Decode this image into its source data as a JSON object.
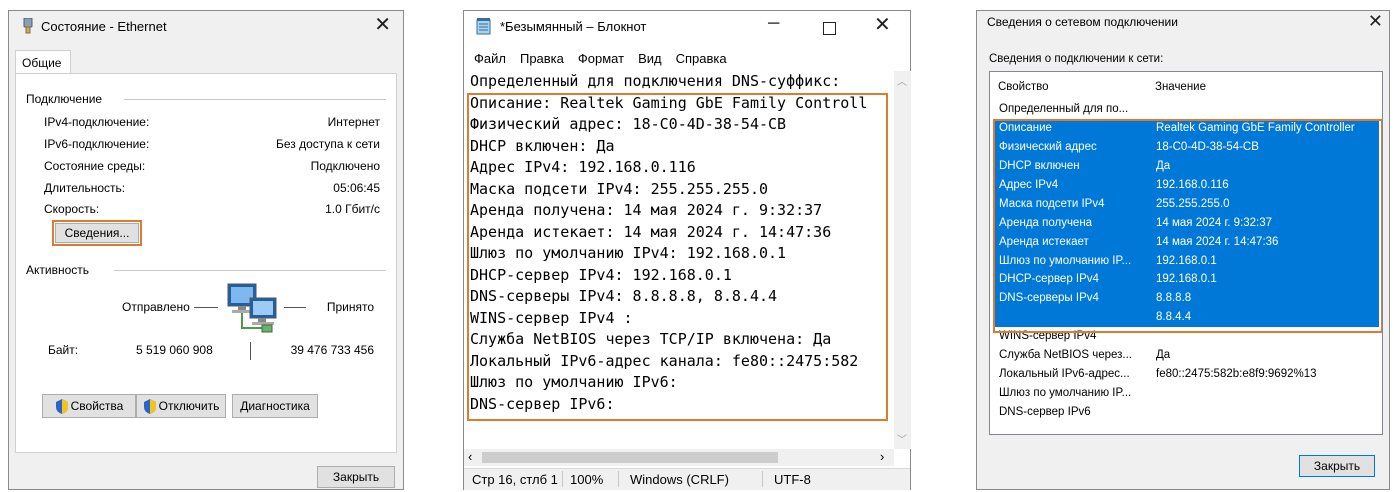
{
  "win1": {
    "title": "Состояние - Ethernet",
    "tab": "Общие",
    "connection_header": "Подключение",
    "rows": [
      {
        "label": "IPv4-подключение:",
        "value": "Интернет"
      },
      {
        "label": "IPv6-подключение:",
        "value": "Без доступа к сети"
      },
      {
        "label": "Состояние среды:",
        "value": "Подключено"
      },
      {
        "label": "Длительность:",
        "value": "05:06:45"
      },
      {
        "label": "Скорость:",
        "value": "1.0 Гбит/с"
      }
    ],
    "details_button": "Сведения...",
    "activity_header": "Активность",
    "sent_label": "Отправлено",
    "received_label": "Принято",
    "bytes_label": "Байт:",
    "bytes_sent": "5 519 060 908",
    "bytes_received": "39 476 733 456",
    "properties_button": "Свойства",
    "disable_button": "Отключить",
    "diagnose_button": "Диагностика",
    "close_button": "Закрыть"
  },
  "win2": {
    "title": "*Безымянный – Блокнот",
    "menu": [
      "Файл",
      "Правка",
      "Формат",
      "Вид",
      "Справка"
    ],
    "lines": [
      "Определенный для подключения DNS-суффикс:",
      "Описание: Realtek Gaming GbE Family Controll",
      "Физический адрес: 18-C0-4D-38-54-CB",
      "DHCP включен: Да",
      "Адрес IPv4: 192.168.0.116",
      "Маска подсети IPv4: 255.255.255.0",
      "Аренда получена: 14 мая 2024 г. 9:32:37",
      "Аренда истекает: 14 мая 2024 г. 14:47:36",
      "Шлюз по умолчанию IPv4: 192.168.0.1",
      "DHCP-сервер IPv4: 192.168.0.1",
      "DNS-серверы IPv4: 8.8.8.8, 8.8.4.4",
      "WINS-сервер IPv4 :",
      "Служба NetBIOS через TCP/IP включена: Да",
      "Локальный IPv6-адрес канала: fe80::2475:582",
      "Шлюз по умолчанию IPv6:",
      "DNS-сервер IPv6:"
    ],
    "status": {
      "position": "Стр 16, стлб 1",
      "zoom": "100%",
      "eol": "Windows (CRLF)",
      "encoding": "UTF-8"
    }
  },
  "win3": {
    "title": "Сведения о сетевом подключении",
    "subtitle": "Сведения о подключении к сети:",
    "col_property": "Свойство",
    "col_value": "Значение",
    "rows": [
      {
        "prop": "Определенный для по...",
        "val": "",
        "sel": false
      },
      {
        "prop": "Описание",
        "val": "Realtek Gaming GbE Family Controller",
        "sel": true
      },
      {
        "prop": "Физический адрес",
        "val": "18-C0-4D-38-54-CB",
        "sel": true
      },
      {
        "prop": "DHCP включен",
        "val": "Да",
        "sel": true
      },
      {
        "prop": "Адрес IPv4",
        "val": "192.168.0.116",
        "sel": true
      },
      {
        "prop": "Маска подсети IPv4",
        "val": "255.255.255.0",
        "sel": true
      },
      {
        "prop": "Аренда получена",
        "val": "14 мая 2024 г. 9:32:37",
        "sel": true
      },
      {
        "prop": "Аренда истекает",
        "val": "14 мая 2024 г. 14:47:36",
        "sel": true
      },
      {
        "prop": "Шлюз по умолчанию IP...",
        "val": "192.168.0.1",
        "sel": true
      },
      {
        "prop": "DHCP-сервер IPv4",
        "val": "192.168.0.1",
        "sel": true
      },
      {
        "prop": "DNS-серверы IPv4",
        "val": "8.8.8.8",
        "sel": true
      },
      {
        "prop": "",
        "val": "8.8.4.4",
        "sel": true
      },
      {
        "prop": "WINS-сервер IPv4",
        "val": "",
        "sel": false
      },
      {
        "prop": "Служба NetBIOS через...",
        "val": "Да",
        "sel": false
      },
      {
        "prop": "Локальный IPv6-адрес...",
        "val": "fe80::2475:582b:e8f9:9692%13",
        "sel": false
      },
      {
        "prop": "Шлюз по умолчанию IP...",
        "val": "",
        "sel": false
      },
      {
        "prop": "DNS-сервер IPv6",
        "val": "",
        "sel": false
      }
    ],
    "close_button": "Закрыть"
  },
  "colors": {
    "highlight": "#e07a2e",
    "selection": "#0078d7",
    "button_focus": "#0078d7"
  },
  "icons": [
    "ethernet-icon",
    "notepad-icon",
    "shield-icon",
    "network-computers-icon",
    "close-icon"
  ]
}
